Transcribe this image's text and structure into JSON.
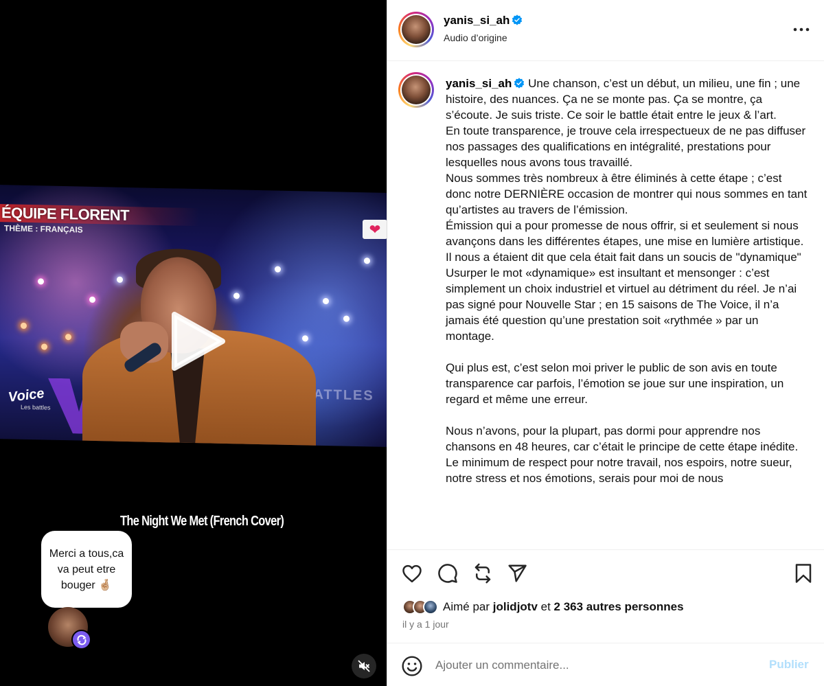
{
  "media": {
    "team_label": "ÉQUIPE FLORENT",
    "theme_label": "THÈME : FRANÇAIS",
    "show_logo": "Voice",
    "show_logo_sub": "Les battles",
    "background_sign": "BATTLES",
    "heart_sticker_icon": "heart-icon",
    "song_title": "The Night We Met (French Cover)",
    "note_text": "Merci a tous,ca va peut etre bouger 🤞🏼",
    "muted": true
  },
  "header": {
    "username": "yanis_si_ah",
    "verified": true,
    "audio": "Audio d’origine"
  },
  "caption": {
    "username": "yanis_si_ah",
    "text": " Une chanson, c’est un début, un milieu, une fin ; une histoire, des nuances. Ça ne se monte pas. Ça se montre, ça s’écoute. Je suis triste. Ce soir le battle était entre le jeux & l’art.\nEn toute transparence, je trouve cela irrespectueux de ne pas diffuser nos passages des qualifications en intégralité, prestations pour lesquelles nous avons tous travaillé.\nNous sommes très nombreux à être éliminés à cette étape ; c’est donc notre DERNIÈRE occasion de montrer qui nous sommes en tant qu’artistes au travers de l’émission.\nÉmission qui a pour promesse de nous offrir, si et seulement si nous avançons dans les différentes étapes, une mise en lumière artistique.\nIl nous a étaient dit que cela était fait dans un soucis de \"dynamique\"\nUsurper le mot «dynamique» est insultant et mensonger : c’est simplement un choix industriel et virtuel au détriment du réel. Je n’ai pas signé pour Nouvelle Star ; en 15 saisons de The Voice, il n’a jamais été question qu’une prestation soit «rythmée » par un montage.\n\nQui plus est, c’est selon moi priver le public de son avis en toute transparence car parfois, l’émotion se joue sur une inspiration, un regard et même une erreur.\n\nNous n’avons, pour la plupart, pas dormi pour apprendre nos chansons en 48 heures, car c’était le principe de cette étape inédite.\nLe minimum de respect pour notre travail, nos espoirs, notre sueur, notre stress et nos émotions, serais pour moi de nous"
  },
  "actions": {
    "like_icon": "heart-outline-icon",
    "comment_icon": "comment-icon",
    "repost_icon": "repost-icon",
    "share_icon": "send-icon",
    "save_icon": "bookmark-icon"
  },
  "likes": {
    "prefix": "Aimé par ",
    "first_user": "jolidjotv",
    "middle": " et ",
    "others": "2 363 autres personnes"
  },
  "timestamp": "il y a 1 jour",
  "comment": {
    "placeholder": "Ajouter un commentaire...",
    "value": "",
    "publish_label": "Publier"
  },
  "colors": {
    "verified": "#0095f6",
    "publish_disabled": "#b2dffc",
    "remix_badge": "#7b5cf0"
  }
}
